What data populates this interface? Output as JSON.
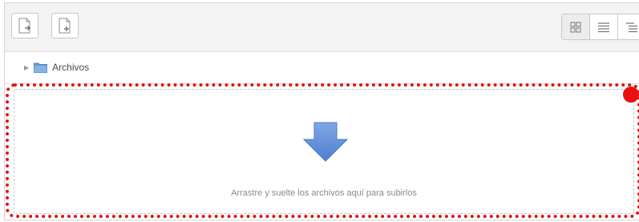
{
  "toolbar": {
    "buttons": [
      {
        "icon": "add-file-icon"
      },
      {
        "icon": "create-folder-icon"
      }
    ],
    "view_modes": [
      {
        "icon": "grid-view-icon",
        "active": true
      },
      {
        "icon": "list-view-icon",
        "active": false
      },
      {
        "icon": "tree-view-icon",
        "active": false
      }
    ]
  },
  "breadcrumb": {
    "folder_label": "Archivos"
  },
  "dropzone": {
    "icon": "arrow-down-icon",
    "text": "Arrastre y suelte los archivos aquí para subirlos"
  },
  "annotation": {
    "border_color": "#e11212",
    "dot_color": "#e81111"
  }
}
